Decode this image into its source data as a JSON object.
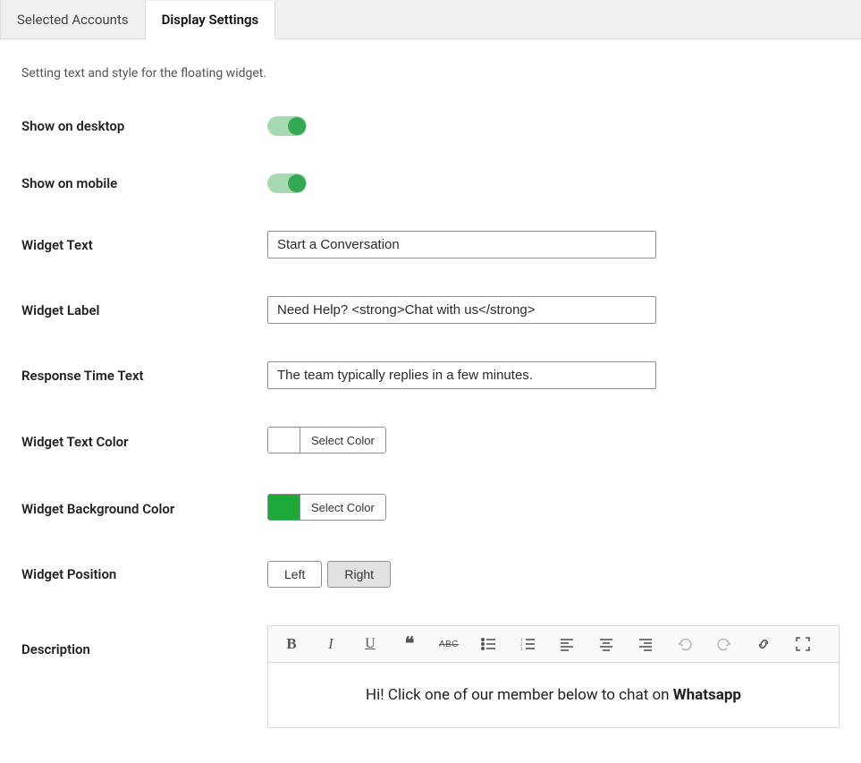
{
  "tabs": {
    "selected_accounts": "Selected Accounts",
    "display_settings": "Display Settings"
  },
  "intro": "Setting text and style for the floating widget.",
  "labels": {
    "show_desktop": "Show on desktop",
    "show_mobile": "Show on mobile",
    "widget_text": "Widget Text",
    "widget_label": "Widget Label",
    "response_time": "Response Time Text",
    "text_color": "Widget Text Color",
    "bg_color": "Widget Background Color",
    "position": "Widget Position",
    "description": "Description"
  },
  "values": {
    "widget_text": "Start a Conversation",
    "widget_label": "Need Help? <strong>Chat with us</strong>",
    "response_time": "The team typically replies in a few minutes."
  },
  "colors": {
    "text_color": "#ffffff",
    "bg_color": "#1ea838",
    "select_label": "Select Color"
  },
  "position": {
    "left": "Left",
    "right": "Right"
  },
  "description_body_pre": "Hi! Click one of our member below to chat on ",
  "description_body_bold": "Whatsapp"
}
